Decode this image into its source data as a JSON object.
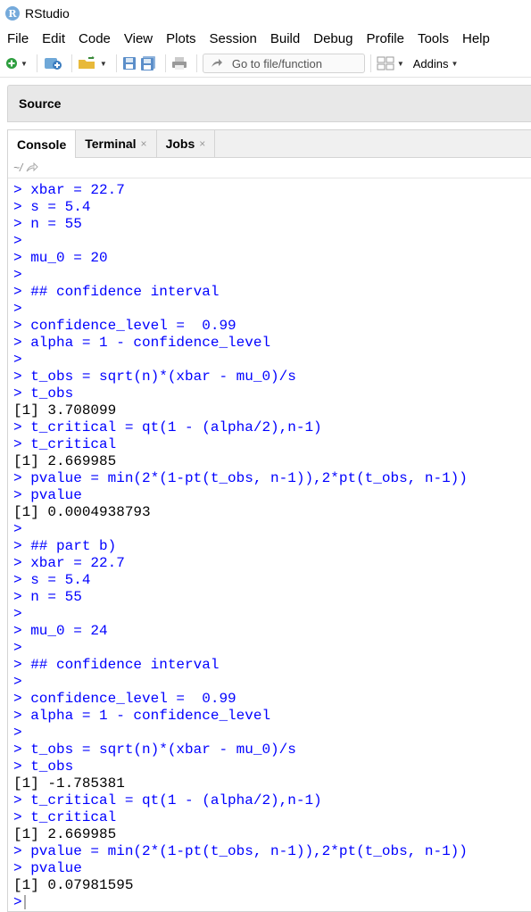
{
  "app": {
    "title": "RStudio",
    "logo_letter": "R"
  },
  "menu": [
    "File",
    "Edit",
    "Code",
    "View",
    "Plots",
    "Session",
    "Build",
    "Debug",
    "Profile",
    "Tools",
    "Help"
  ],
  "toolbar": {
    "goto_placeholder": "Go to file/function",
    "addins_label": "Addins"
  },
  "source_pane": {
    "title": "Source"
  },
  "console_tabs": [
    {
      "label": "Console",
      "closable": false
    },
    {
      "label": "Terminal",
      "closable": true
    },
    {
      "label": "Jobs",
      "closable": true
    }
  ],
  "working_dir": "~/",
  "console_lines": [
    {
      "type": "in",
      "text": "> xbar = 22.7"
    },
    {
      "type": "in",
      "text": "> s = 5.4"
    },
    {
      "type": "in",
      "text": "> n = 55"
    },
    {
      "type": "in",
      "text": ">"
    },
    {
      "type": "in",
      "text": "> mu_0 = 20"
    },
    {
      "type": "in",
      "text": ">"
    },
    {
      "type": "in",
      "text": "> ## confidence interval"
    },
    {
      "type": "in",
      "text": ">"
    },
    {
      "type": "in",
      "text": "> confidence_level =  0.99"
    },
    {
      "type": "in",
      "text": "> alpha = 1 - confidence_level"
    },
    {
      "type": "in",
      "text": ">"
    },
    {
      "type": "in",
      "text": "> t_obs = sqrt(n)*(xbar - mu_0)/s"
    },
    {
      "type": "in",
      "text": "> t_obs"
    },
    {
      "type": "out",
      "text": "[1] 3.708099"
    },
    {
      "type": "in",
      "text": "> t_critical = qt(1 - (alpha/2),n-1)"
    },
    {
      "type": "in",
      "text": "> t_critical"
    },
    {
      "type": "out",
      "text": "[1] 2.669985"
    },
    {
      "type": "in",
      "text": "> pvalue = min(2*(1-pt(t_obs, n-1)),2*pt(t_obs, n-1))"
    },
    {
      "type": "in",
      "text": "> pvalue"
    },
    {
      "type": "out",
      "text": "[1] 0.0004938793"
    },
    {
      "type": "in",
      "text": ">"
    },
    {
      "type": "in",
      "text": "> ## part b)"
    },
    {
      "type": "in",
      "text": "> xbar = 22.7"
    },
    {
      "type": "in",
      "text": "> s = 5.4"
    },
    {
      "type": "in",
      "text": "> n = 55"
    },
    {
      "type": "in",
      "text": ">"
    },
    {
      "type": "in",
      "text": "> mu_0 = 24"
    },
    {
      "type": "in",
      "text": ">"
    },
    {
      "type": "in",
      "text": "> ## confidence interval"
    },
    {
      "type": "in",
      "text": ">"
    },
    {
      "type": "in",
      "text": "> confidence_level =  0.99"
    },
    {
      "type": "in",
      "text": "> alpha = 1 - confidence_level"
    },
    {
      "type": "in",
      "text": ">"
    },
    {
      "type": "in",
      "text": "> t_obs = sqrt(n)*(xbar - mu_0)/s"
    },
    {
      "type": "in",
      "text": "> t_obs"
    },
    {
      "type": "out",
      "text": "[1] -1.785381"
    },
    {
      "type": "in",
      "text": "> t_critical = qt(1 - (alpha/2),n-1)"
    },
    {
      "type": "in",
      "text": "> t_critical"
    },
    {
      "type": "out",
      "text": "[1] 2.669985"
    },
    {
      "type": "in",
      "text": "> pvalue = min(2*(1-pt(t_obs, n-1)),2*pt(t_obs, n-1))"
    },
    {
      "type": "in",
      "text": "> pvalue"
    },
    {
      "type": "out",
      "text": "[1] 0.07981595"
    }
  ],
  "prompt": ">"
}
